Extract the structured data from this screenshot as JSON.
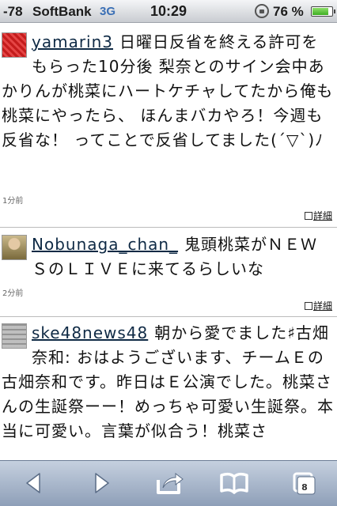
{
  "status_bar": {
    "signal": "-78",
    "carrier": "SoftBank",
    "network": "3G",
    "time": "10:29",
    "battery_percent": "76 %",
    "battery_level": 0.76
  },
  "tweets": [
    {
      "username": "yamarin3",
      "text": "日曜日反省を終える許可をもらった10分後 梨奈とのサイン会中あかりんが桃菜にハートケチャしてたから俺も桃菜にやったら、 ほんまバカやろ！今週も反省な！ ってことで反省してました(´▽`)ﾉ",
      "time": "1分前",
      "detail_label": "詳細"
    },
    {
      "username": "Nobunaga_chan_",
      "text": "鬼頭桃菜がＮＥＷＳのＬＩＶＥに来てるらしいな",
      "time": "2分前",
      "detail_label": "詳細"
    },
    {
      "username": "ske48news48",
      "text": "朝から愛でました♯古畑奈和: おはようございます、チームＥの古畑奈和です。昨日はＥ公演でした。桃菜さんの生誕祭ーー！めっちゃ可愛い生誕祭。本当に可愛い。言葉が似合う！桃菜さ",
      "time": "",
      "detail_label": ""
    }
  ],
  "toolbar": {
    "back_icon": "back-arrow-icon",
    "forward_icon": "forward-arrow-icon",
    "share_icon": "share-icon",
    "bookmarks_icon": "bookmarks-icon",
    "tabs_icon": "tabs-icon",
    "tabs_count": "8"
  }
}
